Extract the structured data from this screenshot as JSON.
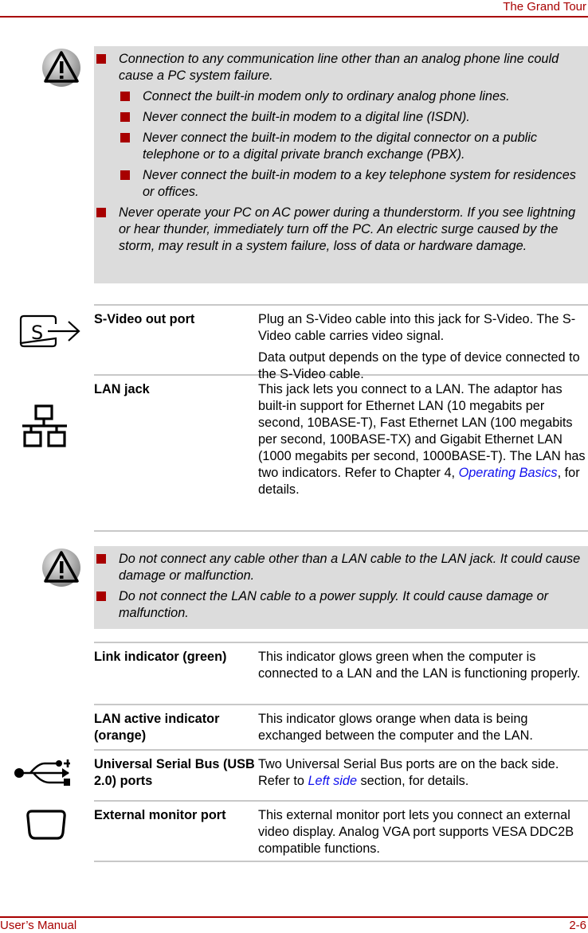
{
  "header": {
    "title": "The Grand Tour"
  },
  "footer": {
    "left": "User’s Manual",
    "right": "2-6"
  },
  "colors": {
    "accent": "#a80000",
    "warning_bg": "#dcdcdc",
    "link": "#1010ee",
    "rule": "#c8c8c8"
  },
  "warning1": {
    "icon": "warning-triangle-icon",
    "items": [
      {
        "level": 1,
        "text": "Connection to any communication line other than an analog phone line could cause a PC system failure."
      },
      {
        "level": 2,
        "text": "Connect the built-in modem only to ordinary analog phone lines."
      },
      {
        "level": 2,
        "text": "Never connect the built-in modem to a digital line (ISDN)."
      },
      {
        "level": 2,
        "text": "Never connect the built-in modem to the digital connector on a public telephone or to a digital private branch exchange (PBX)."
      },
      {
        "level": 2,
        "text": "Never connect the built-in modem to a key telephone system for residences or offices."
      },
      {
        "level": 1,
        "text": "Never operate your PC on AC power during a thunderstorm. If you see lightning or hear thunder, immediately turn off the PC. An electric surge caused by the storm, may result in a system failure, loss of data or hardware damage."
      }
    ]
  },
  "table1": [
    {
      "icon": "s-video-icon",
      "name": "S-Video out port",
      "desc": [
        "Plug an S-Video cable into this jack for S-Video. The S-Video cable carries video signal.",
        "Data output depends on the type of device connected to the S-Video cable."
      ]
    },
    {
      "icon": "lan-network-icon",
      "name": "LAN jack",
      "desc_before": "This jack lets you connect to a LAN. The adaptor has built-in support for Ethernet LAN (10 megabits per second, 10BASE-T), Fast Ethernet LAN (100 megabits per second, 100BASE-TX) and Gigabit Ethernet LAN (1000 megabits per second, 1000BASE-T). The LAN has two indicators. Refer to Chapter 4, ",
      "link": "Operating Basics",
      "desc_after": ", for details."
    }
  ],
  "warning2": {
    "icon": "warning-triangle-icon",
    "items": [
      {
        "level": 1,
        "text": "Do not connect any cable other than a LAN cable to the LAN jack. It could cause damage or malfunction."
      },
      {
        "level": 1,
        "text": "Do not connect the LAN cable to a power supply. It could cause damage or malfunction."
      }
    ]
  },
  "table2": [
    {
      "name": "Link indicator (green)",
      "desc": "This indicator glows green when the computer is connected to a LAN and the LAN is functioning properly."
    },
    {
      "name": "LAN active indicator (orange)",
      "desc": "This indicator glows orange when data is being exchanged between the computer and the LAN."
    },
    {
      "icon": "usb-icon",
      "name": "Universal Serial Bus (USB 2.0) ports",
      "desc_before": "Two Universal Serial Bus ports are on the back side. Refer to ",
      "link": "Left side",
      "desc_after": " section, for details."
    },
    {
      "icon": "external-monitor-icon",
      "name": "External monitor port",
      "desc": "This external monitor port lets you connect an external video display. Analog VGA port supports VESA DDC2B compatible functions."
    }
  ]
}
